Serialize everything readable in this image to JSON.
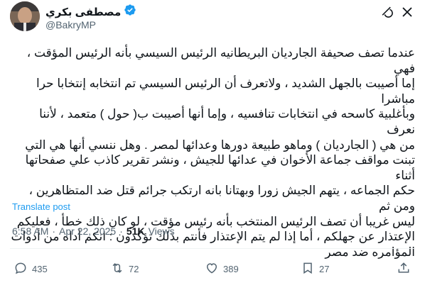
{
  "author": {
    "display_name": "مصطفى بكري",
    "handle": "@BakryMP",
    "verified": true,
    "verified_color": "#1d9bf0"
  },
  "tweet": {
    "lines": [
      "عندما تصف صحيفة الجارديان البريطانيه الرئيس السيسي بأنه الرئيس المؤقت ، فهي",
      "إما أصيبت بالجهل الشديد ، ولاتعرف أن الرئيس السيسي تم انتخابه إنتخابا حرا مباشرا",
      "وبأغلبية كاسحه في انتخابات تنافسيه ، وإما أنها أصيبت ب( حول ) متعمد ، لأننا نعرف",
      "من هي ( الجارديان ) وماهو طبيعة دورها وعدائها لمصر . وهل ننسي أنها هي التي",
      "تبنت مواقف جماعة الأخوان في عدائها للجيش ، ونشر تقرير كاذب علي صفحاتها أثناء",
      "حكم الجماعه ، يتهم الجيش زورا وبهتانا بانه ارتكب جرائم قتل ضد المتظاهرين ، ومن ثم",
      "ليس غريبا أن تصف الرئيس المنتخب بأنه رئيس مؤقت ، لو كان ذلك خطأ ، فعليكم",
      "الإعتذار عن جهلكم ، أما إذا لم يتم الإعتذار فأنتم بذلك تؤكدون : انكم أداه من أدوات",
      "المؤامره ضد مصر"
    ],
    "translate_label": "Translate post",
    "time": "6:58 AM",
    "separator": "·",
    "date": "Apr 22, 2025",
    "views_count": "51K",
    "views_label": "Views"
  },
  "actions": {
    "replies": "435",
    "reposts": "72",
    "likes": "389",
    "bookmarks": "27"
  }
}
